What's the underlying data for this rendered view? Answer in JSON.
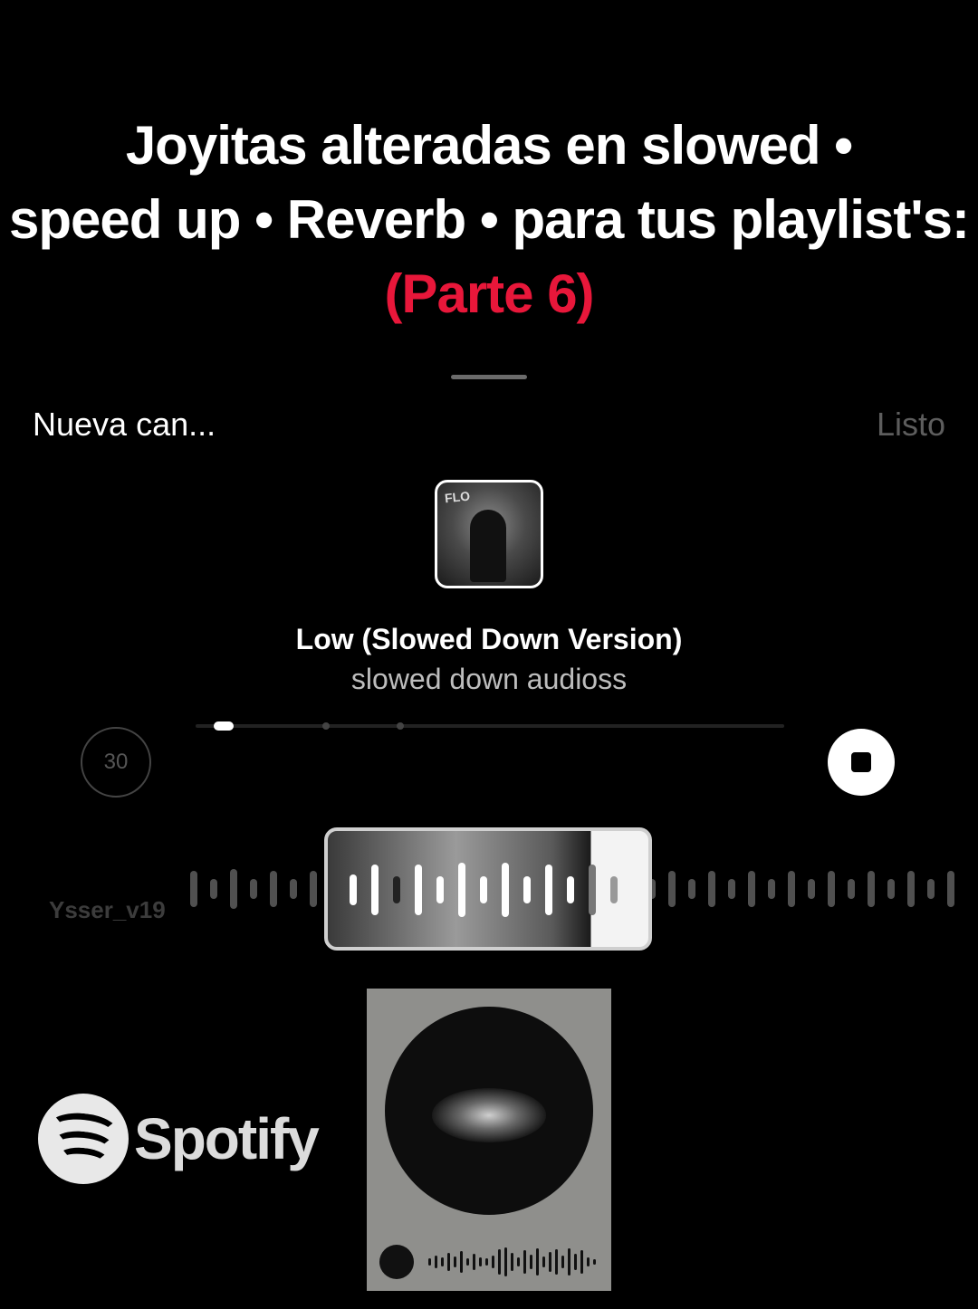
{
  "title": {
    "line1": "Joyitas alteradas en slowed •",
    "line2": "speed up • Reverb • para tus playlist's:",
    "line3": "(Parte 6)"
  },
  "header": {
    "left_label": "Nueva can...",
    "right_label": "Listo"
  },
  "song": {
    "title": "Low (Slowed Down Version)",
    "artist": "slowed down audioss"
  },
  "player": {
    "duration_label": "30",
    "stop_icon": "stop-icon"
  },
  "username": "Ysser_v19",
  "spotify": {
    "wordmark": "Spotify",
    "logo_icon": "spotify-logo-icon"
  },
  "colors": {
    "background": "#000000",
    "accent": "#e8173a",
    "text": "#ffffff",
    "muted": "#5d5d5d"
  }
}
